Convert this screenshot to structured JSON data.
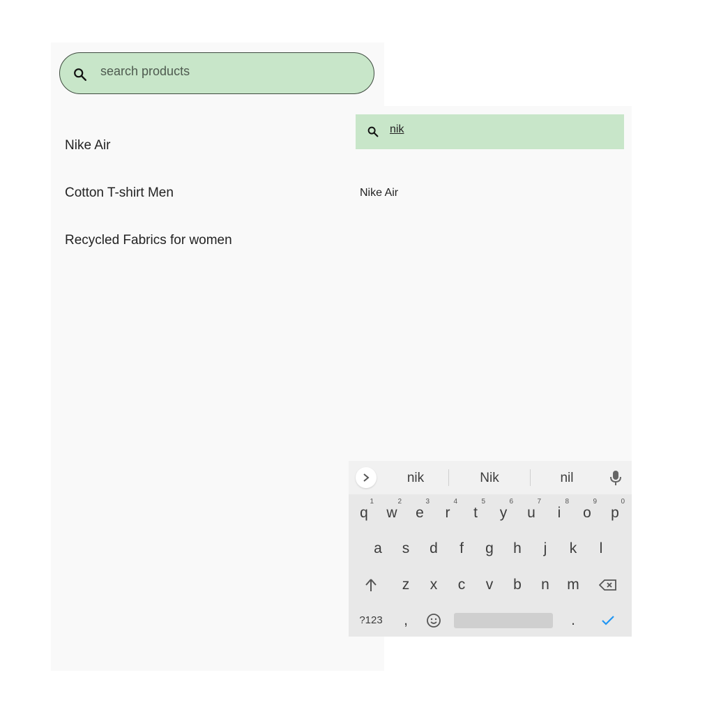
{
  "left_screen": {
    "search": {
      "placeholder": "search products",
      "icon": "search-icon"
    },
    "products": [
      "Nike Air",
      "Cotton T-shirt Men",
      "Recycled Fabrics for women"
    ]
  },
  "right_screen": {
    "search": {
      "query": "nik",
      "icon": "search-icon"
    },
    "results": [
      "Nike Air"
    ]
  },
  "keyboard": {
    "suggestions": [
      "nik",
      "Nik",
      "nil"
    ],
    "row1": [
      {
        "key": "q",
        "hint": "1"
      },
      {
        "key": "w",
        "hint": "2"
      },
      {
        "key": "e",
        "hint": "3"
      },
      {
        "key": "r",
        "hint": "4"
      },
      {
        "key": "t",
        "hint": "5"
      },
      {
        "key": "y",
        "hint": "6"
      },
      {
        "key": "u",
        "hint": "7"
      },
      {
        "key": "i",
        "hint": "8"
      },
      {
        "key": "o",
        "hint": "9"
      },
      {
        "key": "p",
        "hint": "0"
      }
    ],
    "row2": [
      "a",
      "s",
      "d",
      "f",
      "g",
      "h",
      "j",
      "k",
      "l"
    ],
    "row3": [
      "z",
      "x",
      "c",
      "v",
      "b",
      "n",
      "m"
    ],
    "symbols_label": "?123",
    "comma": ",",
    "period": ".",
    "accent_color": "#2196f3",
    "highlight_color": "#c8e6c9"
  }
}
